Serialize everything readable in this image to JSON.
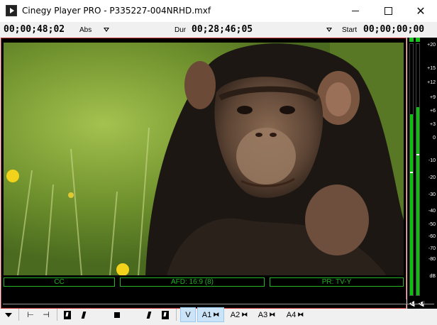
{
  "window": {
    "title": "Cinegy Player PRO - P335227-004NRHD.mxf"
  },
  "timecodes": {
    "position": "00;00;48;02",
    "position_mode": "Abs",
    "duration_label": "Dur",
    "duration": "00;28;46;05",
    "start_label": "Start",
    "start": "00;00;00;00"
  },
  "status": {
    "cc": "CC",
    "afd": "AFD: 16:9 (8)",
    "rating": "PR: TV-Y"
  },
  "meter": {
    "scale": [
      "+20",
      "+15",
      "+12",
      "+9",
      "+6",
      "+3",
      "0",
      "-10",
      "-20",
      "-30",
      "-40",
      "-50",
      "-60",
      "-70",
      "-80",
      "dB"
    ],
    "left_level": 0.72,
    "right_level": 0.75,
    "top_indicator_color": "#1cc31c"
  },
  "timeline": {
    "playhead_fraction": 0.029
  },
  "toolbar": {
    "tracks": [
      "V",
      "A1",
      "A2",
      "A3",
      "A4"
    ],
    "selected": [
      "V",
      "A1"
    ]
  },
  "colors": {
    "status_green": "#23b123",
    "frame_red": "#c83a3a",
    "meter_green": "#0fbf0f",
    "selection_blue": "#cce4f7"
  }
}
